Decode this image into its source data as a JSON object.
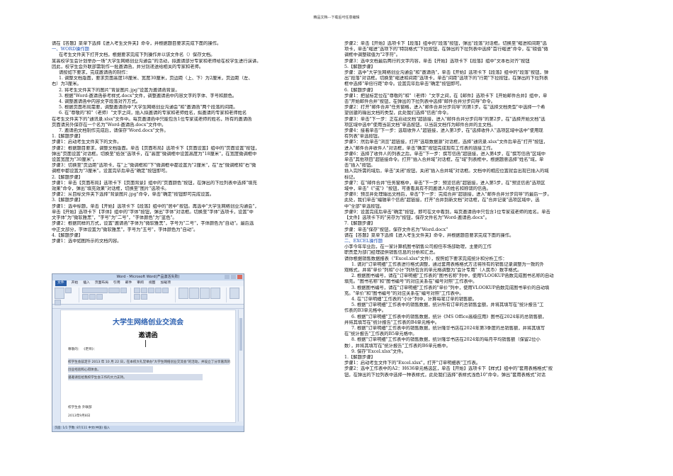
{
  "header": "精品文档---下载后可任意编辑",
  "left_column": [
    {
      "text": "请在【答题】菜单下选择【进入考生文件夹】命令，并根据题目要求完成下面的操作。"
    },
    {
      "text": "一、WORD操作题",
      "sec": true
    },
    {
      "text": "在考生文件夹下打开文档，根据要求完成下列操作并以该文件名（）保存文档。",
      "ind": true
    },
    {
      "text": "某高校学生会计划举办一场\"大学生网络创业沟通会\"的活动，拟邀请部分专家和老师给在校学生进行演讲。"
    },
    {
      "text": "因此，校学生会外联部需制作一批邀请函，并分别递送给相关的专家和老师。"
    },
    {
      "text": "请按如下要求，完成邀请函的制作：",
      "ind": true
    },
    {
      "text": "1. 调整文档版面，要求页面高度18厘米、宽度30厘米，页边距（上、下）为2厘米，页边距（左、",
      "ind": true
    },
    {
      "text": "右）为3厘米。"
    },
    {
      "text": "2. 将考生文件夹下的图片\"背景图片.jpg\"设置为邀请函背景。",
      "ind": true
    },
    {
      "text": "3. 根据\"Word-邀请函参考样式.docx\"文件，调整邀请函中内容文字的字体、字号和颜色。",
      "ind": true
    },
    {
      "text": "4. 调整邀请函中内容文字段落对齐方式。",
      "ind": true
    },
    {
      "text": "5. 根据页面布局需要，调整邀请函中\"大学生网络创业沟通会\"和\"邀请函\"两个段落的间距。",
      "ind": true
    },
    {
      "text": "6. 在\"尊敬的\"和\"（老师）\"文字之间，插入拟邀请的专家和老师姓名，拟邀请的专家和老师姓名",
      "ind": true
    },
    {
      "text": "在考生文件夹下的\"通讯录.xlsx\"文件中。每页邀请函中只能包含1位专家或老师的姓名，所有的邀请函"
    },
    {
      "text": "页面请另外保存在一个名为\"Word-邀请函.docx\"文件中。"
    },
    {
      "text": "7. 邀请函文档制作完成后，请保存\"Word.docx\"文件。",
      "ind": true
    },
    {
      "text": "1.【解题步骤】"
    },
    {
      "text": "步骤1：启动考生文件夹下的文件。"
    },
    {
      "text": "步骤2：根据题目要求，调整文档版面。单击【页面布局】选项卡下【页面设置】组中的\"页面设置\"按钮，"
    },
    {
      "text": "弹出\"页面设置\"对话框。切换至\"纸张\"选项卡，在\"高度\"微调框中设置高度为\"18厘米\"，在宽度微调框中"
    },
    {
      "text": "设置宽度为\"30厘米\"。"
    },
    {
      "text": "步骤3：切换至\"页边距\"选项卡，在\"上\"微调框和\"下\"微调框中都设置为\"2厘米\"，在\"左\"微调框和\"右\"微"
    },
    {
      "text": "调框中都设置为\"3厘米\"。设置完毕后单击\"确定\"按钮即可。"
    },
    {
      "text": "2.【解题步骤】"
    },
    {
      "text": "步骤1：单击【页面布局】选项卡下【页面背景】组中的\"页面颜色\"按钮，在弹出的下拉列表中选择\"填充"
    },
    {
      "text": "效果\"命令，弹出\"填充效果\"对话框，切换至\"图片\"选项卡。"
    },
    {
      "text": "步骤2：从目标文件夹下选择\"背景图片.jpg\"命令，单击\"确定\"按钮即可完成设置。"
    },
    {
      "text": "3.【解题步骤】"
    },
    {
      "text": "步骤1：选中标题，单击【开始】选项卡下【段落】组中的\"居中\"按钮。再选中\"大学生网络创业沟通会\"，"
    },
    {
      "text": "单击【开始】选项卡下【字体】组中的\"字体\"按钮，弹出\"字体\"对话框。切换至\"字体\"选项卡，设置\"中"
    },
    {
      "text": "文字体\"为\"微软雅黑\"，\"字号\"为\"二号\"，\"字体颜色\"为\"蓝色\"。"
    },
    {
      "text": "步骤2：根据同样的方式，设置\"邀请函\"字体为\"微软雅黑\"，字号为\"二号\"，字体颜色为\"自动\"。最后选"
    },
    {
      "text": "中正文部分，字体设置为\"微软雅黑\"，字号为\"五号\"，字体颜色为\"自动\"。"
    },
    {
      "text": "4.【解题步骤】"
    },
    {
      "text": "步骤1：选中如图所示的文档内容。"
    }
  ],
  "right_column": [
    {
      "text": "步骤2：单击【开始】选项卡下【段落】组中的\"段落\"按钮，弹出\"段落\"对话框。切换至\"缩进和间距\"选"
    },
    {
      "text": "项卡，单击\"缩进\"选项下的\"特别格式\"下拉按钮，在弹出的下拉列表中选择\"首行缩进\"命令，在\"磅值\"微"
    },
    {
      "text": "调框中调整磅值为\"2字符\"。"
    },
    {
      "text": "步骤3：选中文档最后两行的文字内容，单击【开始】选项卡下【段落】组中\"文本右对齐\"按钮"
    },
    {
      "text": "5.【解题步骤】"
    },
    {
      "text": "步骤：选中\"大学生网络创业沟通会\"和\"邀请函\"，单击【开始】选项卡下【段落】组中的\"段落\"按钮，弹"
    },
    {
      "text": "出\"段落\"对话框。切换至\"缩进和间距\"选项卡，单击\"间距\"选项下的\"行距\"下拉按钮，在弹出的下拉列表"
    },
    {
      "text": "框中选择\"单倍行距\"命令。设置完毕后单击\"确定\"按钮即可。"
    },
    {
      "text": "6.【解题步骤】"
    },
    {
      "text": "步骤1：把鼠标定位在\"尊敬的\"和\"（老师）\"文字之间，在【邮件】选项卡下【开始邮件合并】组中，单"
    },
    {
      "text": "击\"开始邮件合并\"按钮，在弹出的下拉列表中选择\"邮件合并分步向导\"命令。"
    },
    {
      "text": "步骤2：打开\"邮件合并\"任务窗格，进入\"邮件合并分步向导\"的第1步。在\"选择文档类型\"中选择一个希"
    },
    {
      "text": "望创建的输出文档的类型，此处我们选择\"信函\"命令。"
    },
    {
      "text": "步骤3：单击\"下一步：正在启动文档\"超链接，进入\"邮件合并分步向导\"的第2步，在\"选择开始文档\"选"
    },
    {
      "text": "项区域中选中\"使用当前文档\"单选按钮，以当前文档作为邮件合并的主文档。"
    },
    {
      "text": "步骤4：接着单击\"下一步：选取收件人\"超链接，进入第3步，在\"选择收件人\"选项区域中选中\"使用现"
    },
    {
      "text": "有列表\"单选按钮。"
    },
    {
      "text": "步骤5：然后单击\"浏览\"超链接，打开\"选取数据源\"对话框，选择\"通讯录.xlsx\"文件后单击\"打开\"按钮，"
    },
    {
      "text": "进入\"邮件合并收件人\"对话框，单击\"确定\"按钮完成现有工作表的链接工作。"
    },
    {
      "text": "步骤6：选择了收件人的列表之后，单击\"下一步：撰写信函\"超链接，进入第4步，在\"撰写信函\"区域中"
    },
    {
      "text": "单击\"其他项目\"超链接命令。打开\"插入合并域\"对话框，在\"域\"列表框中，根据题意选择\"姓名\"域，单"
    },
    {
      "text": "击\"插入\"按钮。"
    },
    {
      "text": "插入完所需的域后，单击\"关闭\"按钮，关闭\"插入合并域\"对话框。文档中的相应位置就会出现已插入的域"
    },
    {
      "text": "标记。"
    },
    {
      "text": "步骤7：在\"邮件合并\"任务窗格中，单击\"下一步：预览信函\"超链接，进入第5步，在\"预览信函\"选项区"
    },
    {
      "text": "域中，单击\"《\"或\"》\"按钮，可查看具有不同邀请人的姓名和称谓的信函。"
    },
    {
      "text": "步骤8：预览并处理输出文档后，单击\"下一步：完成合并\"超链接，进入\"邮件合并分步向导\"的最后一步。"
    },
    {
      "text": "此处，我们单击\"编辑单个信函\"超链接，打开\"合并到新文档\"对话框，在\"合并记录\"选项区域中，选"
    },
    {
      "text": "中\"全部\"单选按钮。"
    },
    {
      "text": "步骤9：设置完成后单击\"确定\"按钮，即可在文中看到，每页邀请函中只包含1位专家或老师的姓名。单击"
    },
    {
      "text": "【文件】选项卡下的\"另存为\"按钮，保存文件名为\"Word-邀请函.docx\"。"
    },
    {
      "text": "7.【解题步骤】"
    },
    {
      "text": "步骤：单击\"保存\"按钮，保存文件名为\"Word.docx\""
    },
    {
      "text": "请在【答题】菜单下选择【进入考生文件夹】命令，并根据题目要求完成下面的操作。"
    },
    {
      "text": "二、EXCEL操作题",
      "sec": true
    },
    {
      "text": "小李今年毕业后，在一家计算机图书销售公司担任市场部助理，主要的工作"
    },
    {
      "text": "职责是为部门经理提供销售信息的分析和汇总。"
    },
    {
      "text": "请你根据销售数据报表（\"Excel.xlsx\"文件），按照如下要求完成统计和分析工作："
    },
    {
      "text": "1. 请对\"订单明细\"工作表进行格式调整，通过套用表格格式方法将所有的销售记录调整为一致的外",
      "ind": true
    },
    {
      "text": "观格式，并将\"单价\"列和\"小计\"列所包含的单元格调整为\"会计专用\"（人民币）数字格式。"
    },
    {
      "text": "2. 根据图书编号，请在\"订单明细\"工作表的\"图书名称\"列中，使用VLOOKUP函数完成图书名称的自动",
      "ind": true
    },
    {
      "text": "填充。\"图书名称\"和\"图书编号\"的对应关系在\"编号对照\"工作表中。"
    },
    {
      "text": "3. 根据图书编号，请在\"订单明细\"工作表的\"单价\"列中，使用VLOOKUP函数完成图书单价的自动填",
      "ind": true
    },
    {
      "text": "充。\"单价\"和\"图书编号\"的对应关系在\"编号对照\"工作表中。"
    },
    {
      "text": "4. 在\"订单明细\"工作表的\"小计\"列中，计算每笔订单的销售额。",
      "ind": true
    },
    {
      "text": "5. 根据\"订单明细\"工作表中的销售数据，统计所有订单的总销售金额，并将其填写在\"统计报告\"工",
      "ind": true
    },
    {
      "text": "作表的B3单元格中。"
    },
    {
      "text": "6. 根据\"订单明细\"工作表中的销售数据，统计《MS Office高级应用》图书在2024年的总销售额，",
      "ind": true
    },
    {
      "text": "并将其填写在\"统计报告\"工作表的B4单元格中。"
    },
    {
      "text": "7. 根据\"订单明细\"工作表中的销售数据，统计隆华书店在2024年第3季度的总销售额，并将其填写",
      "ind": true
    },
    {
      "text": "在\"统计报告\"工作表的B5单元格中。"
    },
    {
      "text": "8. 根据\"订单明细\"工作表中的销售数据，统计隆华书店在2024年的每月平均销售额（保留2位小",
      "ind": true
    },
    {
      "text": "数），并将其填写在\"统计报告\"工作表的B6单元格中。"
    },
    {
      "text": "9. 保存\"Excel.xlsx\"文件。",
      "ind": true
    },
    {
      "text": "1.【解题步骤】"
    },
    {
      "text": "步骤1：启动考生文件下的\"Excel.xlsx\"，打开\"订单明细表\"工作表。"
    },
    {
      "text": "步骤2：选中工作表中的A2：H636单元格选区，单击【开始】选项卡下【样式】组中的\"套用表格格式\"按"
    },
    {
      "text": "钮，在弹出的下拉列表中选择一种表样式，此处我们选择\"表样式浅色10\"命令。弹出\"套用表格式\"对话"
    }
  ],
  "screenshot": {
    "title": "Word - Microsoft Word(产品激活失败)",
    "menu": [
      "文件",
      "开始",
      "插入",
      "页面布局",
      "引用",
      "邮件",
      "审阅",
      "视图",
      "加载项"
    ],
    "doc_title": "大学生网络创业交流会",
    "doc_subtitle": "邀请函",
    "salutation": "尊敬的：      《老师》：",
    "body_lines": [
      "校学生会兹定于 2013 年 10 月 22 日，在本校大礼堂举办\"大学生网络创业交流会\"的活动，并设立了分享嘉宾的",
      "创业经验和心得体会。",
      "谨邀请您给我校学生会工作的大力支持。"
    ],
    "sign_lines": [
      "校学生会 外联部",
      "2013年9月8日"
    ],
    "status": "页面: 1/1  字数: 87/111  中文(中国)  插入"
  }
}
